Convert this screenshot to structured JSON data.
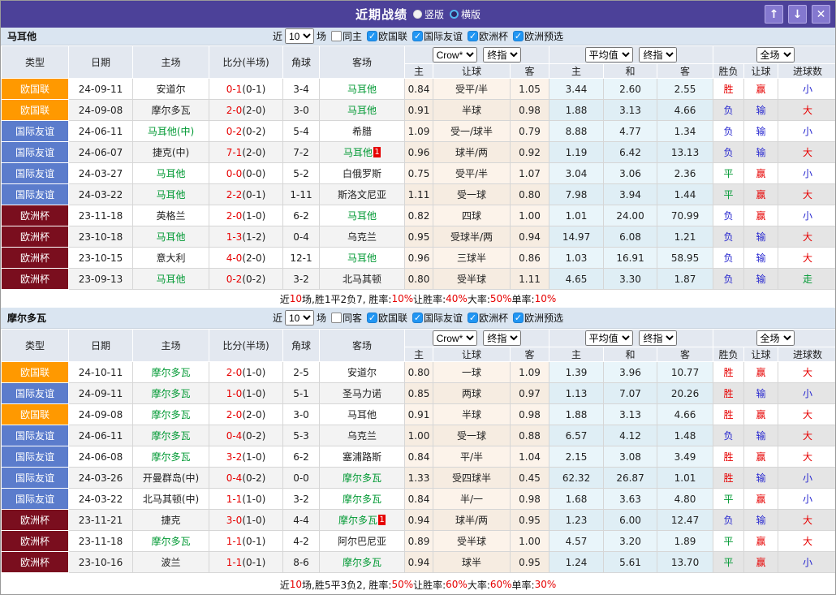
{
  "icons": {
    "check": "✓",
    "up_arrow": "↑",
    "down_arrow": "↓",
    "close": "✕"
  },
  "colors": {
    "titlebar": "#4c4199",
    "accent_red": "#e60000",
    "accent_blue": "#2727cf",
    "accent_green": "#009933"
  },
  "league_colors": {
    "欧国联": "#ff9900",
    "国际友谊": "#5b7ccc",
    "欧洲杯": "#7a0e1e"
  },
  "result_colors": {
    "胜": "#e60000",
    "平": "#009933",
    "负": "#2727cf",
    "赢": "#e60000",
    "输": "#2727cf",
    "大": "#e60000",
    "小": "#2727cf",
    "走": "#009933"
  },
  "titlebar": {
    "title": "近期战绩",
    "radio_vertical": "竖版",
    "radio_horizontal": "横版"
  },
  "table_headers": {
    "type": "类型",
    "date": "日期",
    "home": "主场",
    "score": "比分(半场)",
    "corner": "角球",
    "away": "客场",
    "odds_sub": [
      "主",
      "让球",
      "客"
    ],
    "avg_sub": [
      "主",
      "和",
      "客"
    ],
    "result_sub": [
      "胜负",
      "让球",
      "进球数"
    ],
    "select_crow": "Crow*",
    "select_final1": "终指",
    "select_avg": "平均值",
    "select_final2": "终指",
    "select_scope": "全场"
  },
  "sections": [
    {
      "team": "马耳他",
      "filter": {
        "near_label": "近",
        "games": "10",
        "games_suffix": "场",
        "same_label": "同主",
        "leagues": [
          "欧国联",
          "国际友谊",
          "欧洲杯",
          "欧洲预选"
        ]
      },
      "rows": [
        {
          "lg": "欧国联",
          "date": "24-09-11",
          "home": "安道尔",
          "hg": false,
          "score": "0-1",
          "half": "(0-1)",
          "cn": "3-4",
          "away": "马耳他",
          "ag": true,
          "ab": "",
          "o1": "0.84",
          "hc": "受平/半",
          "o2": "1.05",
          "a1": "3.44",
          "a2": "2.60",
          "a3": "2.55",
          "r1": "胜",
          "r2": "赢",
          "r3": "小"
        },
        {
          "lg": "欧国联",
          "date": "24-09-08",
          "home": "摩尔多瓦",
          "hg": false,
          "score": "2-0",
          "half": "(2-0)",
          "cn": "3-0",
          "away": "马耳他",
          "ag": true,
          "ab": "",
          "o1": "0.91",
          "hc": "半球",
          "o2": "0.98",
          "a1": "1.88",
          "a2": "3.13",
          "a3": "4.66",
          "r1": "负",
          "r2": "输",
          "r3": "大"
        },
        {
          "lg": "国际友谊",
          "date": "24-06-11",
          "home": "马耳他(中)",
          "hg": true,
          "score": "0-2",
          "half": "(0-2)",
          "cn": "5-4",
          "away": "希腊",
          "ag": false,
          "ab": "",
          "o1": "1.09",
          "hc": "受一/球半",
          "o2": "0.79",
          "a1": "8.88",
          "a2": "4.77",
          "a3": "1.34",
          "r1": "负",
          "r2": "输",
          "r3": "小"
        },
        {
          "lg": "国际友谊",
          "date": "24-06-07",
          "home": "捷克(中)",
          "hg": false,
          "score": "7-1",
          "half": "(2-0)",
          "cn": "7-2",
          "away": "马耳他",
          "ag": true,
          "ab": "1",
          "o1": "0.96",
          "hc": "球半/两",
          "o2": "0.92",
          "a1": "1.19",
          "a2": "6.42",
          "a3": "13.13",
          "r1": "负",
          "r2": "输",
          "r3": "大"
        },
        {
          "lg": "国际友谊",
          "date": "24-03-27",
          "home": "马耳他",
          "hg": true,
          "score": "0-0",
          "half": "(0-0)",
          "cn": "5-2",
          "away": "白俄罗斯",
          "ag": false,
          "ab": "",
          "o1": "0.75",
          "hc": "受平/半",
          "o2": "1.07",
          "a1": "3.04",
          "a2": "3.06",
          "a3": "2.36",
          "r1": "平",
          "r2": "赢",
          "r3": "小"
        },
        {
          "lg": "国际友谊",
          "date": "24-03-22",
          "home": "马耳他",
          "hg": true,
          "score": "2-2",
          "half": "(0-1)",
          "cn": "1-11",
          "away": "斯洛文尼亚",
          "ag": false,
          "ab": "",
          "o1": "1.11",
          "hc": "受一球",
          "o2": "0.80",
          "a1": "7.98",
          "a2": "3.94",
          "a3": "1.44",
          "r1": "平",
          "r2": "赢",
          "r3": "大"
        },
        {
          "lg": "欧洲杯",
          "date": "23-11-18",
          "home": "英格兰",
          "hg": false,
          "score": "2-0",
          "half": "(1-0)",
          "cn": "6-2",
          "away": "马耳他",
          "ag": true,
          "ab": "",
          "o1": "0.82",
          "hc": "四球",
          "o2": "1.00",
          "a1": "1.01",
          "a2": "24.00",
          "a3": "70.99",
          "r1": "负",
          "r2": "赢",
          "r3": "小"
        },
        {
          "lg": "欧洲杯",
          "date": "23-10-18",
          "home": "马耳他",
          "hg": true,
          "score": "1-3",
          "half": "(1-2)",
          "cn": "0-4",
          "away": "乌克兰",
          "ag": false,
          "ab": "",
          "o1": "0.95",
          "hc": "受球半/两",
          "o2": "0.94",
          "a1": "14.97",
          "a2": "6.08",
          "a3": "1.21",
          "r1": "负",
          "r2": "输",
          "r3": "大"
        },
        {
          "lg": "欧洲杯",
          "date": "23-10-15",
          "home": "意大利",
          "hg": false,
          "score": "4-0",
          "half": "(2-0)",
          "cn": "12-1",
          "away": "马耳他",
          "ag": true,
          "ab": "",
          "o1": "0.96",
          "hc": "三球半",
          "o2": "0.86",
          "a1": "1.03",
          "a2": "16.91",
          "a3": "58.95",
          "r1": "负",
          "r2": "输",
          "r3": "大"
        },
        {
          "lg": "欧洲杯",
          "date": "23-09-13",
          "home": "马耳他",
          "hg": true,
          "score": "0-2",
          "half": "(0-2)",
          "cn": "3-2",
          "away": "北马其顿",
          "ag": false,
          "ab": "",
          "o1": "0.80",
          "hc": "受半球",
          "o2": "1.11",
          "a1": "4.65",
          "a2": "3.30",
          "a3": "1.87",
          "r1": "负",
          "r2": "输",
          "r3": "走"
        }
      ],
      "summary": [
        {
          "text": "近",
          "red": false
        },
        {
          "text": "10",
          "red": true
        },
        {
          "text": "场,胜1平2负7, 胜率:",
          "red": false
        },
        {
          "text": "10%",
          "red": true
        },
        {
          "text": " 让胜率:",
          "red": false
        },
        {
          "text": "40%",
          "red": true
        },
        {
          "text": " 大率:",
          "red": false
        },
        {
          "text": "50%",
          "red": true
        },
        {
          "text": " 单率:",
          "red": false
        },
        {
          "text": "10%",
          "red": true
        }
      ]
    },
    {
      "team": "摩尔多瓦",
      "filter": {
        "near_label": "近",
        "games": "10",
        "games_suffix": "场",
        "same_label": "同客",
        "leagues": [
          "欧国联",
          "国际友谊",
          "欧洲杯",
          "欧洲预选"
        ]
      },
      "rows": [
        {
          "lg": "欧国联",
          "date": "24-10-11",
          "home": "摩尔多瓦",
          "hg": true,
          "score": "2-0",
          "half": "(1-0)",
          "cn": "2-5",
          "away": "安道尔",
          "ag": false,
          "ab": "",
          "o1": "0.80",
          "hc": "一球",
          "o2": "1.09",
          "a1": "1.39",
          "a2": "3.96",
          "a3": "10.77",
          "r1": "胜",
          "r2": "赢",
          "r3": "大"
        },
        {
          "lg": "国际友谊",
          "date": "24-09-11",
          "home": "摩尔多瓦",
          "hg": true,
          "score": "1-0",
          "half": "(1-0)",
          "cn": "5-1",
          "away": "圣马力诺",
          "ag": false,
          "ab": "",
          "o1": "0.85",
          "hc": "两球",
          "o2": "0.97",
          "a1": "1.13",
          "a2": "7.07",
          "a3": "20.26",
          "r1": "胜",
          "r2": "输",
          "r3": "小"
        },
        {
          "lg": "欧国联",
          "date": "24-09-08",
          "home": "摩尔多瓦",
          "hg": true,
          "score": "2-0",
          "half": "(2-0)",
          "cn": "3-0",
          "away": "马耳他",
          "ag": false,
          "ab": "",
          "o1": "0.91",
          "hc": "半球",
          "o2": "0.98",
          "a1": "1.88",
          "a2": "3.13",
          "a3": "4.66",
          "r1": "胜",
          "r2": "赢",
          "r3": "大"
        },
        {
          "lg": "国际友谊",
          "date": "24-06-11",
          "home": "摩尔多瓦",
          "hg": true,
          "score": "0-4",
          "half": "(0-2)",
          "cn": "5-3",
          "away": "乌克兰",
          "ag": false,
          "ab": "",
          "o1": "1.00",
          "hc": "受一球",
          "o2": "0.88",
          "a1": "6.57",
          "a2": "4.12",
          "a3": "1.48",
          "r1": "负",
          "r2": "输",
          "r3": "大"
        },
        {
          "lg": "国际友谊",
          "date": "24-06-08",
          "home": "摩尔多瓦",
          "hg": true,
          "score": "3-2",
          "half": "(1-0)",
          "cn": "6-2",
          "away": "塞浦路斯",
          "ag": false,
          "ab": "",
          "o1": "0.84",
          "hc": "平/半",
          "o2": "1.04",
          "a1": "2.15",
          "a2": "3.08",
          "a3": "3.49",
          "r1": "胜",
          "r2": "赢",
          "r3": "大"
        },
        {
          "lg": "国际友谊",
          "date": "24-03-26",
          "home": "开曼群岛(中)",
          "hg": false,
          "score": "0-4",
          "half": "(0-2)",
          "cn": "0-0",
          "away": "摩尔多瓦",
          "ag": true,
          "ab": "",
          "o1": "1.33",
          "hc": "受四球半",
          "o2": "0.45",
          "a1": "62.32",
          "a2": "26.87",
          "a3": "1.01",
          "r1": "胜",
          "r2": "输",
          "r3": "小"
        },
        {
          "lg": "国际友谊",
          "date": "24-03-22",
          "home": "北马其顿(中)",
          "hg": false,
          "score": "1-1",
          "half": "(1-0)",
          "cn": "3-2",
          "away": "摩尔多瓦",
          "ag": true,
          "ab": "",
          "o1": "0.84",
          "hc": "半/一",
          "o2": "0.98",
          "a1": "1.68",
          "a2": "3.63",
          "a3": "4.80",
          "r1": "平",
          "r2": "赢",
          "r3": "小"
        },
        {
          "lg": "欧洲杯",
          "date": "23-11-21",
          "home": "捷克",
          "hg": false,
          "score": "3-0",
          "half": "(1-0)",
          "cn": "4-4",
          "away": "摩尔多瓦",
          "ag": true,
          "ab": "1",
          "o1": "0.94",
          "hc": "球半/两",
          "o2": "0.95",
          "a1": "1.23",
          "a2": "6.00",
          "a3": "12.47",
          "r1": "负",
          "r2": "输",
          "r3": "大"
        },
        {
          "lg": "欧洲杯",
          "date": "23-11-18",
          "home": "摩尔多瓦",
          "hg": true,
          "score": "1-1",
          "half": "(0-1)",
          "cn": "4-2",
          "away": "阿尔巴尼亚",
          "ag": false,
          "ab": "",
          "o1": "0.89",
          "hc": "受半球",
          "o2": "1.00",
          "a1": "4.57",
          "a2": "3.20",
          "a3": "1.89",
          "r1": "平",
          "r2": "赢",
          "r3": "大"
        },
        {
          "lg": "欧洲杯",
          "date": "23-10-16",
          "home": "波兰",
          "hg": false,
          "score": "1-1",
          "half": "(0-1)",
          "cn": "8-6",
          "away": "摩尔多瓦",
          "ag": true,
          "ab": "",
          "o1": "0.94",
          "hc": "球半",
          "o2": "0.95",
          "a1": "1.24",
          "a2": "5.61",
          "a3": "13.70",
          "r1": "平",
          "r2": "赢",
          "r3": "小"
        }
      ],
      "summary": [
        {
          "text": "近",
          "red": false
        },
        {
          "text": "10",
          "red": true
        },
        {
          "text": "场,胜5平3负2, 胜率:",
          "red": false
        },
        {
          "text": "50%",
          "red": true
        },
        {
          "text": " 让胜率:",
          "red": false
        },
        {
          "text": "60%",
          "red": true
        },
        {
          "text": " 大率:",
          "red": false
        },
        {
          "text": "60%",
          "red": true
        },
        {
          "text": " 单率:",
          "red": false
        },
        {
          "text": "30%",
          "red": true
        }
      ]
    }
  ]
}
